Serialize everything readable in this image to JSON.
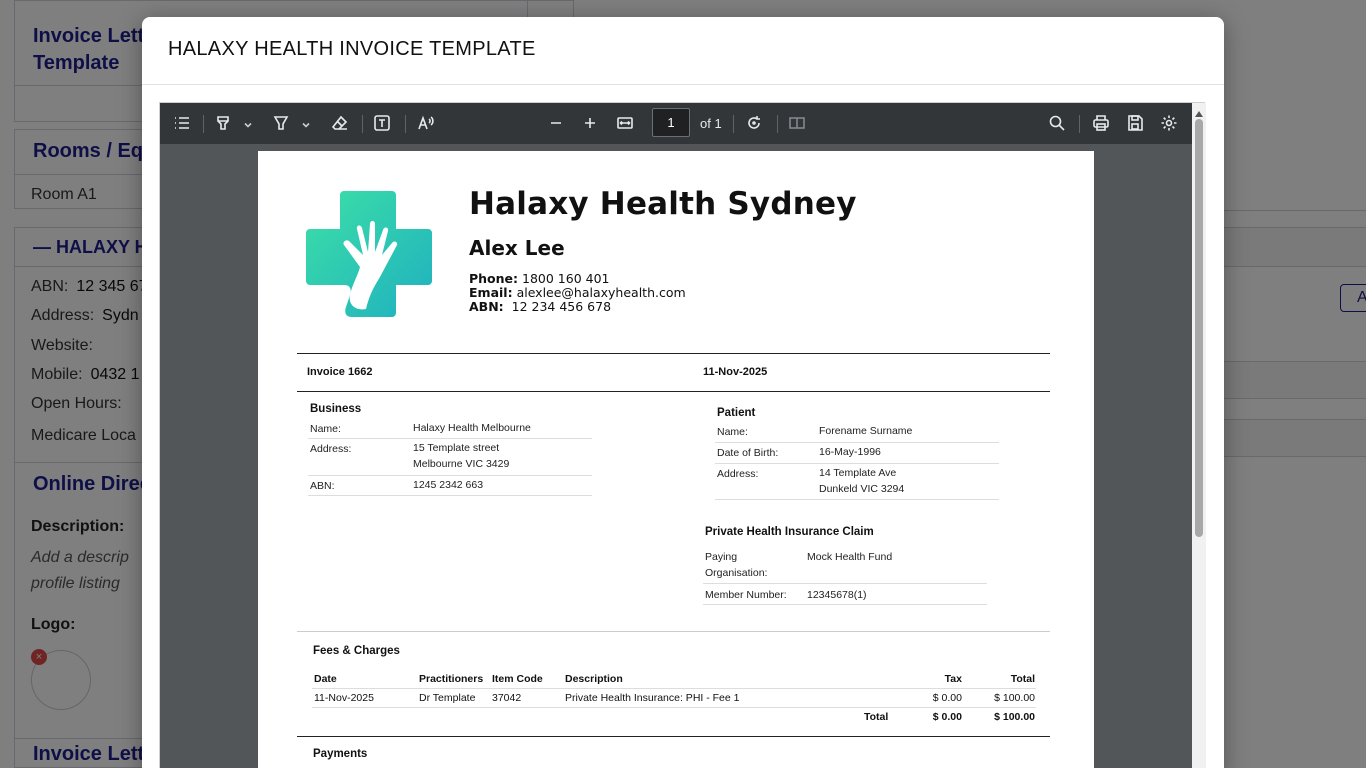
{
  "background": {
    "card1_heading": "Invoice Letter Template",
    "card1_heading_line1": "Invoice Lett",
    "card1_heading_line2": "Template",
    "rooms_heading": "Rooms / Equ",
    "room_item": "Room A1",
    "location_heading": "— HALAXY H",
    "abn_label": "ABN:",
    "abn_value": "12 345 67",
    "address_label": "Address:",
    "address_value": "Sydn",
    "website_label": "Website:",
    "mobile_label": "Mobile:",
    "mobile_value": "0432 1",
    "open_hours_label": "Open Hours:",
    "medicare_label": "Medicare Loca",
    "online_directory_heading": "Online Direc",
    "description_label": "Description:",
    "description_placeholder_line1": "Add a descrip",
    "description_placeholder_line2": "profile listing",
    "logo_label": "Logo:",
    "invoice_letter_heading2": "Invoice Lett",
    "right_button": "A"
  },
  "modal": {
    "title": "HALAXY HEALTH INVOICE TEMPLATE"
  },
  "pdf_toolbar": {
    "page_current": "1",
    "page_of": "of 1"
  },
  "invoice": {
    "clinic_name": "Halaxy Health Sydney",
    "practitioner_name": "Alex Lee",
    "phone_label": "Phone:",
    "phone_value": "1800 160 401",
    "email_label": "Email:",
    "email_value": "alexlee@halaxyhealth.com",
    "abn_label": "ABN:",
    "abn_value": "12 234 456 678",
    "invoice_number": "Invoice 1662",
    "invoice_date": "11-Nov-2025",
    "business": {
      "title": "Business",
      "name_label": "Name:",
      "name_value": "Halaxy Health Melbourne",
      "address_label": "Address:",
      "address_line1": "15 Template street",
      "address_line2": "Melbourne VIC 3429",
      "abn_label": "ABN:",
      "abn_value": "1245 2342 663"
    },
    "patient": {
      "title": "Patient",
      "name_label": "Name:",
      "name_value": "Forename Surname",
      "dob_label": "Date of Birth:",
      "dob_value": "16-May-1996",
      "address_label": "Address:",
      "address_line1": "14 Template Ave",
      "address_line2": "Dunkeld VIC 3294"
    },
    "phi": {
      "title": "Private Health Insurance Claim",
      "paying_label_line1": "Paying",
      "paying_label_line2": "Organisation:",
      "paying_value": "Mock Health Fund",
      "member_label": "Member Number:",
      "member_value": "12345678(1)"
    },
    "fees": {
      "title": "Fees & Charges",
      "columns": {
        "date": "Date",
        "practitioners": "Practitioners",
        "item_code": "Item Code",
        "description": "Description",
        "tax": "Tax",
        "total": "Total"
      },
      "rows": [
        {
          "date": "11-Nov-2025",
          "practitioner": "Dr Template",
          "item_code": "37042",
          "description": "Private Health Insurance: PHI - Fee 1",
          "tax": "$ 0.00",
          "total": "$ 100.00"
        }
      ],
      "total_label": "Total",
      "total_tax": "$ 0.00",
      "total_amount": "$ 100.00"
    },
    "payments_title": "Payments"
  },
  "colors": {
    "accent": "#1f1f8f",
    "logo_teal": "#2fc4a8",
    "toolbar": "#323639",
    "viewer_bg": "#525659"
  }
}
